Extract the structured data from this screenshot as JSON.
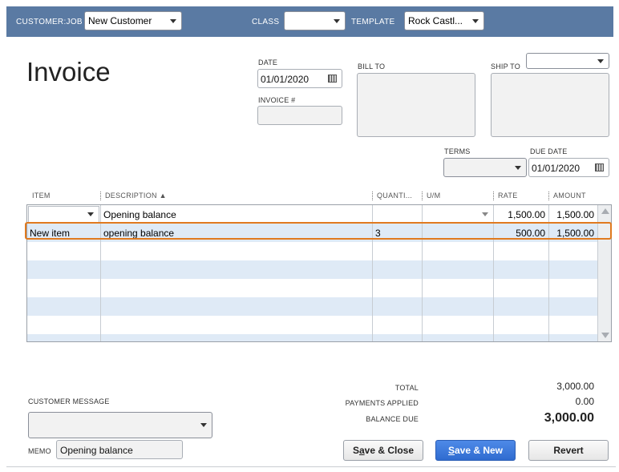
{
  "header": {
    "customer_job_label": "CUSTOMER:JOB",
    "customer_job_value": "New Customer",
    "class_label": "CLASS",
    "class_value": "",
    "template_label": "TEMPLATE",
    "template_value": "Rock Castl..."
  },
  "form": {
    "title": "Invoice",
    "date_label": "DATE",
    "date_value": "01/01/2020",
    "invoice_no_label": "INVOICE #",
    "invoice_no_value": "",
    "bill_to_label": "BILL TO",
    "ship_to_label": "SHIP TO",
    "terms_label": "TERMS",
    "terms_value": "",
    "due_date_label": "DUE DATE",
    "due_date_value": "01/01/2020"
  },
  "table": {
    "columns": [
      "ITEM",
      "DESCRIPTION ▲",
      "QUANTI...",
      "U/M",
      "RATE",
      "AMOUNT"
    ],
    "rows": [
      {
        "item": "",
        "description": "Opening balance",
        "quantity": "",
        "um": "",
        "rate": "1,500.00",
        "amount": "1,500.00"
      },
      {
        "item": "New item",
        "description": "opening balance",
        "quantity": "3",
        "um": "",
        "rate": "500.00",
        "amount": "1,500.00"
      }
    ]
  },
  "totals": {
    "total_label": "TOTAL",
    "total_value": "3,000.00",
    "payments_label": "PAYMENTS APPLIED",
    "payments_value": "0.00",
    "balance_label": "BALANCE DUE",
    "balance_value": "3,000.00"
  },
  "footer": {
    "customer_message_label": "CUSTOMER MESSAGE",
    "customer_message_value": "",
    "memo_label": "MEMO",
    "memo_value": "Opening balance",
    "save_close_pre": "S",
    "save_close_u": "a",
    "save_close_post": "ve & Close",
    "save_new_pre": "",
    "save_new_u": "S",
    "save_new_post": "ave & New",
    "revert_label": "Revert"
  },
  "colors": {
    "header_bar": "#5a7aa3",
    "row_alt": "#dfeaf6",
    "highlight": "#e07a1f",
    "primary_button": "#2f6bd0"
  }
}
